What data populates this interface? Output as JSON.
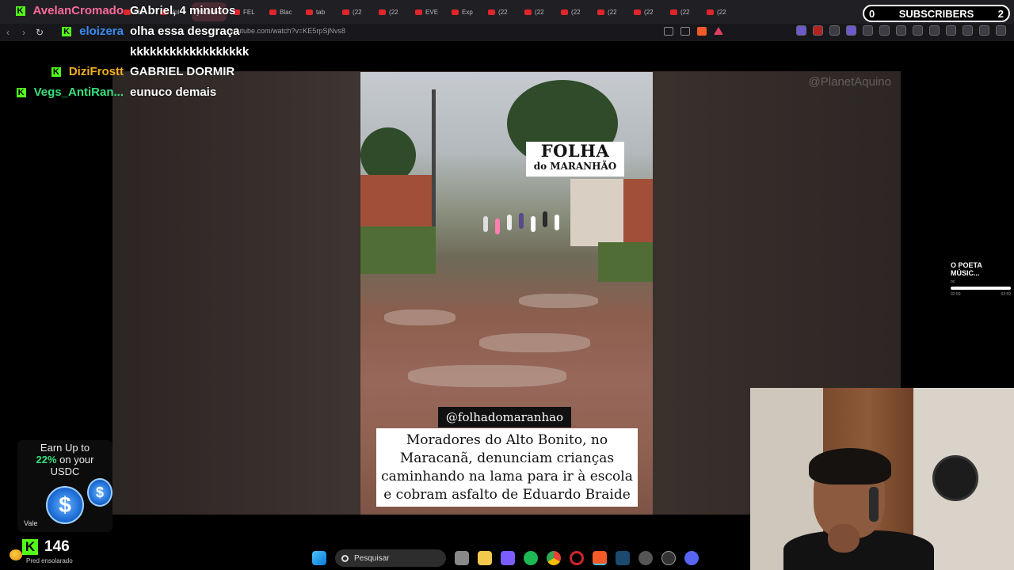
{
  "browser": {
    "tabs": [
      {
        "label": "Mic",
        "active": false
      },
      {
        "label": "Vol",
        "active": false
      },
      {
        "label": "youtube",
        "active": true
      },
      {
        "label": "FEL",
        "active": false
      },
      {
        "label": "Blac",
        "active": false
      },
      {
        "label": "tab",
        "active": false
      },
      {
        "label": "(22",
        "active": false
      },
      {
        "label": "(22",
        "active": false
      },
      {
        "label": "EVE",
        "active": false
      },
      {
        "label": "Exp",
        "active": false
      },
      {
        "label": "(22",
        "active": false
      },
      {
        "label": "(22",
        "active": false
      },
      {
        "label": "(22",
        "active": false
      },
      {
        "label": "(22",
        "active": false
      },
      {
        "label": "(22",
        "active": false
      },
      {
        "label": "(22",
        "active": false
      },
      {
        "label": "(22",
        "active": false
      }
    ],
    "url": "youtube.com/watch?v=KE5rpSjNvs8"
  },
  "chat": [
    {
      "user": "AvelanCromado",
      "color": "#ff6a9a",
      "badge": "K",
      "message": "GAbriel, 4 minutos"
    },
    {
      "user": "eloizera",
      "color": "#3a8df0",
      "badge": "K",
      "message": "olha essa desgraça"
    },
    {
      "user": "",
      "color": "#ffffff",
      "badge": "",
      "message": "kkkkkkkkkkkkkkkkkk"
    },
    {
      "user": "DiziFrostt",
      "color": "#f2b01e",
      "badge": "K",
      "message": "GABRIEL DORMIR"
    },
    {
      "user": "Vegs_AntiRan...",
      "color": "#35e07a",
      "badge": "K",
      "message": "eunuco demais"
    }
  ],
  "subscribers": {
    "label": "SUBSCRIBERS",
    "left_count": "0",
    "right_count": "2"
  },
  "video": {
    "watermark": "@PlanetAquino",
    "logo_line1": "FOLHA",
    "logo_line2": "do MARANHÃO",
    "handle": "@folhadomaranhao",
    "caption": "Moradores do Alto Bonito, no Maracanã, denunciam crianças caminhando na lama para ir à escola e cobram asfalto de Eduardo Braide"
  },
  "music": {
    "title": "O POETA MÚSIC...",
    "artist": "oc",
    "time_start": "02:59",
    "time_end": "02:59",
    "progress": 1.0
  },
  "ad": {
    "line1": "Earn Up to",
    "highlight": "22%",
    "line2_rest": " on your",
    "line3": "USDC",
    "coin_symbol": "$",
    "vale": "Vale"
  },
  "kick": {
    "follower_count": "146",
    "logo": "K"
  },
  "taskbar": {
    "weather": "Pred ensolarado",
    "search_placeholder": "Pesquisar"
  }
}
